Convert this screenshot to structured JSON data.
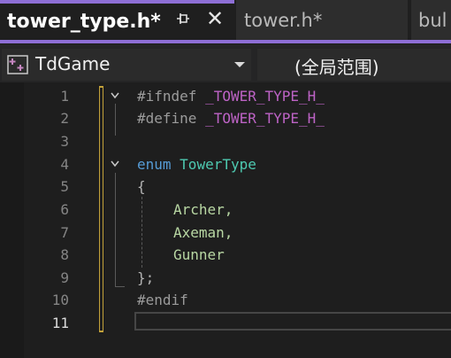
{
  "tabs": [
    {
      "label": "tower_type.h*",
      "active": true
    },
    {
      "label": "tower.h*",
      "active": false
    },
    {
      "label": "bul",
      "active": false
    }
  ],
  "navbar": {
    "scope": "TdGame",
    "member": "(全局范围)"
  },
  "editor": {
    "lines": [
      {
        "num": "1",
        "text": "#ifndef _TOWER_TYPE_H_"
      },
      {
        "num": "2",
        "text": "#define _TOWER_TYPE_H_"
      },
      {
        "num": "3",
        "text": ""
      },
      {
        "num": "4",
        "text": "enum TowerType"
      },
      {
        "num": "5",
        "text": "{"
      },
      {
        "num": "6",
        "text": "Archer,"
      },
      {
        "num": "7",
        "text": "Axeman,"
      },
      {
        "num": "8",
        "text": "Gunner"
      },
      {
        "num": "9",
        "text": "};"
      },
      {
        "num": "10",
        "text": "#endif"
      },
      {
        "num": "11",
        "text": ""
      }
    ],
    "tokens": {
      "ifndef": "#ifndef",
      "define": "#define",
      "macro": "_TOWER_TYPE_H_",
      "enum": "enum",
      "typename": "TowerType",
      "open": "{",
      "close": "};",
      "endif": "#endif"
    },
    "current_line": "11"
  },
  "colors": {
    "accent": "#8e6fd6",
    "keyword": "#569cd6",
    "type": "#4ec9b0",
    "macro": "#bd63c5",
    "enum_value": "#b8d7a3",
    "change_marker": "#c3a23a"
  }
}
